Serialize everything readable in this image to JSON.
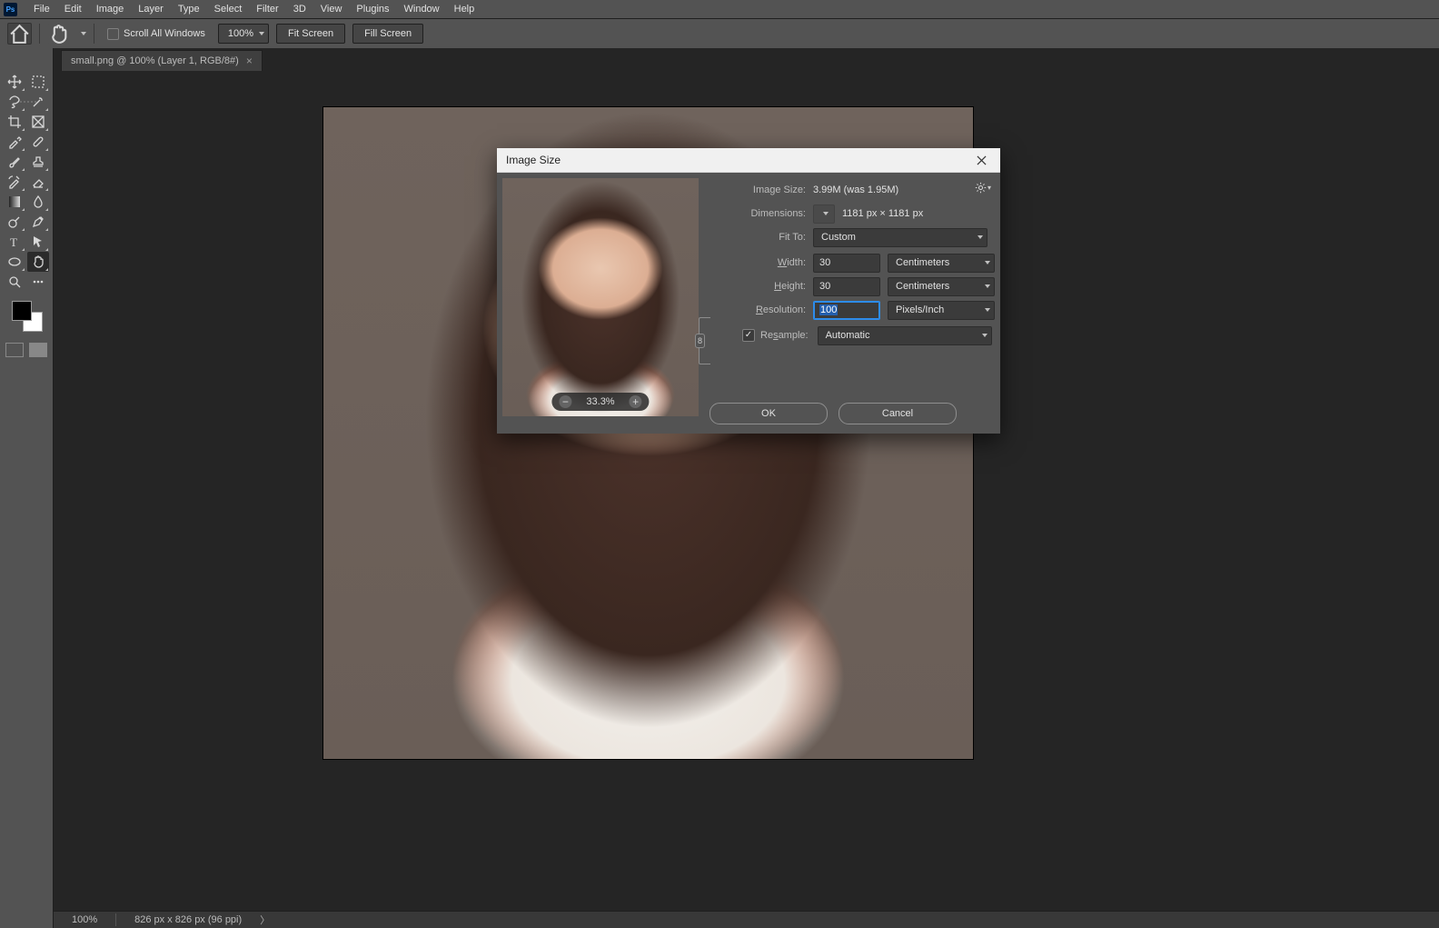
{
  "menu": {
    "items": [
      "File",
      "Edit",
      "Image",
      "Layer",
      "Type",
      "Select",
      "Filter",
      "3D",
      "View",
      "Plugins",
      "Window",
      "Help"
    ]
  },
  "options": {
    "scroll_all": "Scroll All Windows",
    "zoom": "100%",
    "fit": "Fit Screen",
    "fill": "Fill Screen"
  },
  "document": {
    "tab_title": "small.png @ 100% (Layer 1, RGB/8#)"
  },
  "status": {
    "zoom": "100%",
    "info": "826 px x 826 px (96 ppi)"
  },
  "dialog": {
    "title": "Image Size",
    "image_size_label": "Image Size:",
    "image_size_value": "3.99M (was 1.95M)",
    "dimensions_label": "Dimensions:",
    "dimensions_value": "1181 px  ×  1181 px",
    "fit_to_label": "Fit To:",
    "fit_to_value": "Custom",
    "width_label": "Width:",
    "width_value": "30",
    "width_unit": "Centimeters",
    "height_label": "Height:",
    "height_value": "30",
    "height_unit": "Centimeters",
    "resolution_label": "Resolution:",
    "resolution_value": "100",
    "resolution_unit": "Pixels/Inch",
    "resample_label": "Resample:",
    "resample_value": "Automatic",
    "preview_zoom": "33.3%",
    "ok": "OK",
    "cancel": "Cancel",
    "mnemonics": {
      "width": "W",
      "height": "H",
      "resolution": "R",
      "resample": "s"
    }
  }
}
